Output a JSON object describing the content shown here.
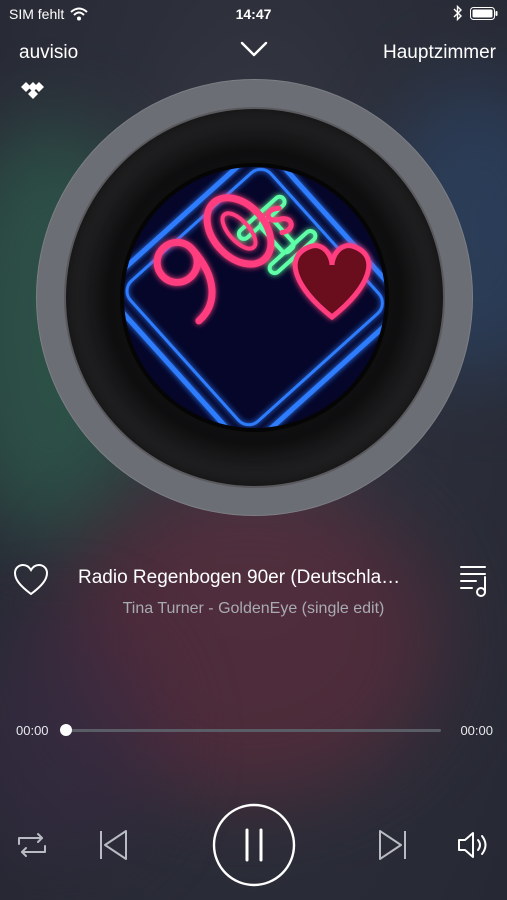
{
  "status_bar": {
    "carrier": "SIM fehlt",
    "time": "14:47"
  },
  "header": {
    "left_label": "auvisio",
    "right_label": "Hauptzimmer"
  },
  "track": {
    "title": "Radio Regenbogen 90er (Deutschla…",
    "subtitle": "Tina Turner - GoldenEye (single edit)"
  },
  "progress": {
    "elapsed": "00:00",
    "duration": "00:00",
    "position": 0
  },
  "artwork": {
    "text": "I ♥ 90s"
  },
  "colors": {
    "neon_pink": "#ff3d7f",
    "neon_green": "#5effa8",
    "neon_blue": "#2f7dff"
  },
  "icons": [
    "wifi-icon",
    "bluetooth-icon",
    "battery-icon",
    "chevron-down-icon",
    "tidal-icon",
    "heart-icon",
    "queue-icon",
    "repeat-icon",
    "previous-icon",
    "pause-icon",
    "next-icon",
    "volume-icon"
  ]
}
